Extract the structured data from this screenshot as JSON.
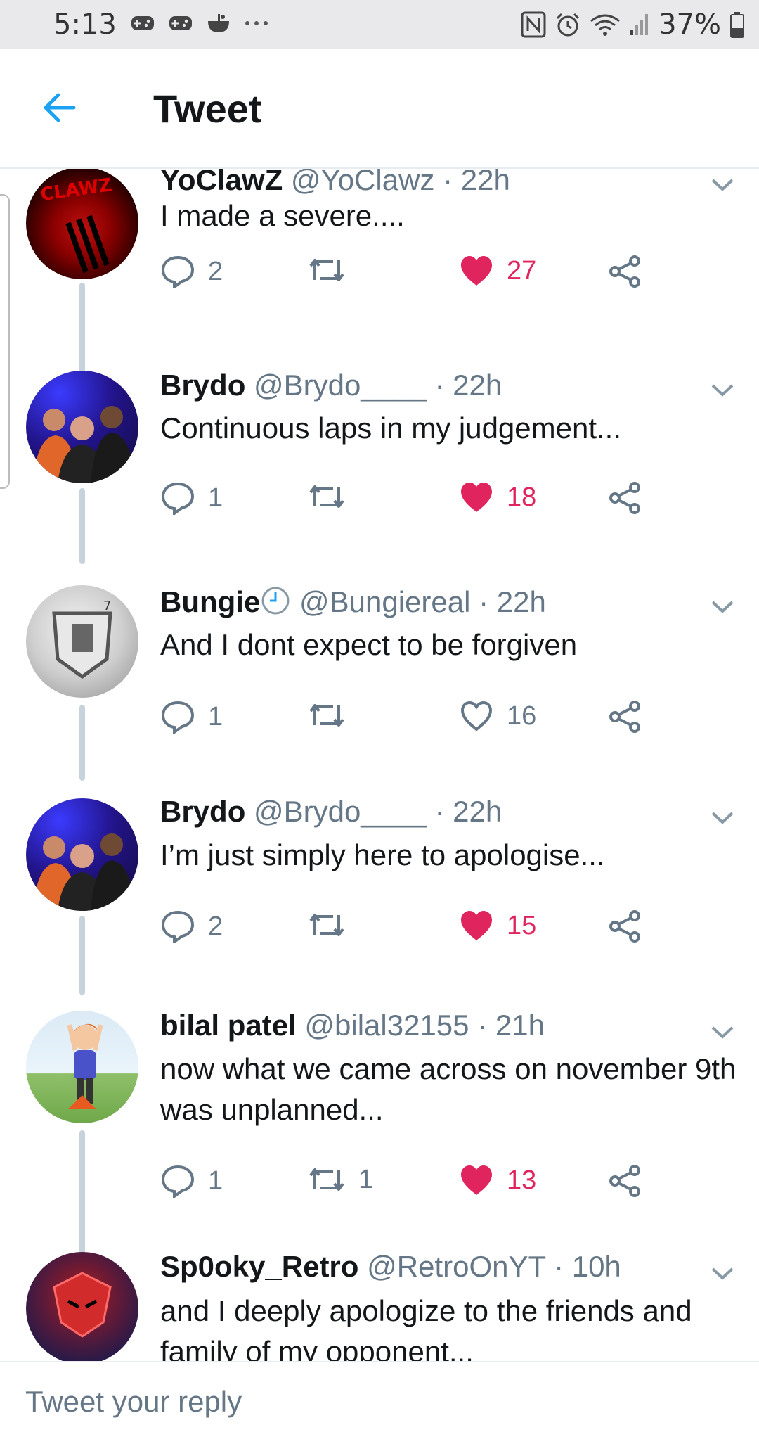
{
  "status_bar": {
    "time": "5:13",
    "battery": "37%",
    "left_icons": [
      "gamepad-icon",
      "gamepad-icon",
      "bowl-icon",
      "more-dots-icon"
    ],
    "right_icons": [
      "nfc-icon",
      "alarm-icon",
      "wifi-icon",
      "signal-icon",
      "battery-icon"
    ]
  },
  "header": {
    "title": "Tweet",
    "back_icon": "back-arrow-icon",
    "accent": "#1da1f2"
  },
  "colors": {
    "like": "#e0245e",
    "meta": "#657786",
    "text": "#14171a",
    "thread_line": "#c7d3dc"
  },
  "tweets": [
    {
      "name": "YoClawZ",
      "handle": "@YoClawz",
      "time": "· 22h",
      "text": "I made a severe....",
      "replies": "2",
      "retweets": "",
      "likes": "27",
      "liked": true
    },
    {
      "name": "Brydo",
      "handle": "@Brydo____",
      "time": "· 22h",
      "text": "Continuous laps in my judgement...",
      "replies": "1",
      "retweets": "",
      "likes": "18",
      "liked": true
    },
    {
      "name": "Bungie",
      "handle": "@Bungiereal",
      "time": "· 22h",
      "text": "And I dont expect to be forgiven",
      "replies": "1",
      "retweets": "",
      "likes": "16",
      "liked": false,
      "name_badge": "clock-icon"
    },
    {
      "name": "Brydo",
      "handle": "@Brydo____",
      "time": "· 22h",
      "text": "I’m just simply here to apologise...",
      "replies": "2",
      "retweets": "",
      "likes": "15",
      "liked": true
    },
    {
      "name": "bilal patel",
      "handle": "@bilal32155",
      "time": "· 21h",
      "text": "now what we came across on november 9th was unplanned...",
      "replies": "1",
      "retweets": "1",
      "likes": "13",
      "liked": true
    },
    {
      "name": "Sp0oky_Retro",
      "handle": "@RetroOnYT",
      "time": "· 10h",
      "text": "and I deeply apologize to the friends and family of my opponent...",
      "replies": "",
      "retweets": "",
      "likes": "",
      "liked": false
    }
  ],
  "reply_bar": {
    "placeholder": "Tweet your reply"
  }
}
